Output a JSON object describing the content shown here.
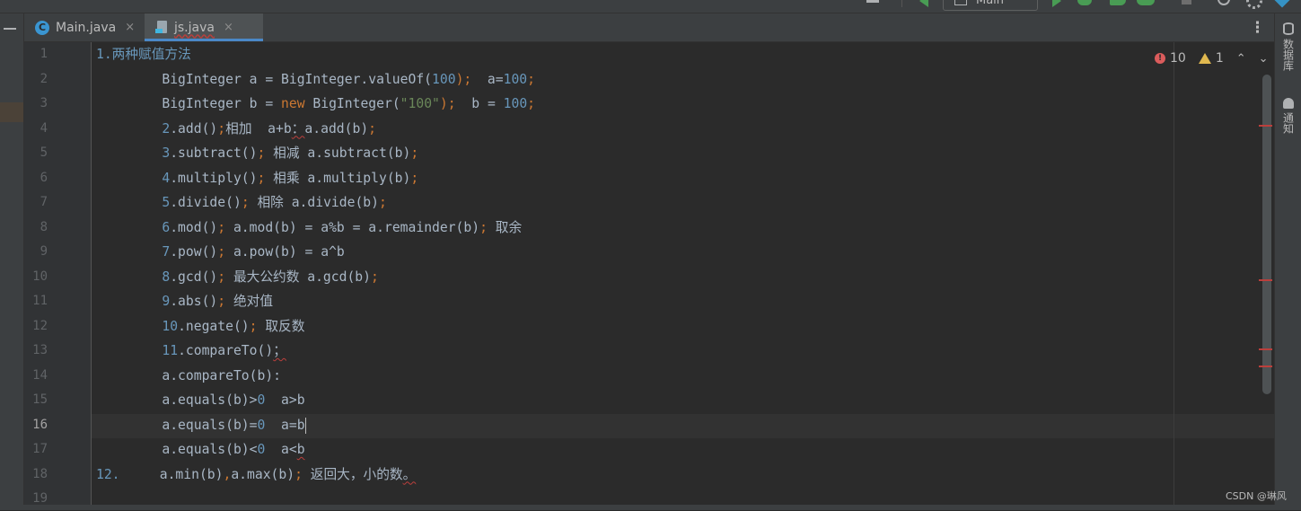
{
  "toolbar": {
    "run_config": "Main",
    "icons": [
      "minimize-icon",
      "back-run-icon",
      "run-icon",
      "debug-icon",
      "coverage-icon",
      "profile-icon",
      "stop-icon",
      "search-icon",
      "gear-icon",
      "update-icon"
    ]
  },
  "tabs": [
    {
      "label": "Main.java",
      "icon": "java-class-icon",
      "close": "×",
      "active": false
    },
    {
      "label": "js.java",
      "icon": "java-file-icon",
      "close": "×",
      "active": true
    }
  ],
  "inspection": {
    "errors": "10",
    "warnings": "1",
    "error_glyph": "!",
    "up": "⌃",
    "down": "⌄"
  },
  "tab_menu": "⋮",
  "current_line": 16,
  "line_numbers": [
    "1",
    "2",
    "3",
    "4",
    "5",
    "6",
    "7",
    "8",
    "9",
    "10",
    "11",
    "12",
    "13",
    "14",
    "15",
    "16",
    "17",
    "18",
    "19"
  ],
  "code_lines": [
    [
      {
        "t": "1.两种赋值方法",
        "c": "num1"
      }
    ],
    [
      {
        "t": "    BigInteger a = BigInteger.valueOf(",
        "c": "plain"
      },
      {
        "t": "100",
        "c": "num"
      },
      {
        "t": ");",
        "c": "semi"
      },
      {
        "t": "  a=",
        "c": "plain"
      },
      {
        "t": "100",
        "c": "num"
      },
      {
        "t": ";",
        "c": "semi"
      }
    ],
    [
      {
        "t": "    BigInteger b = ",
        "c": "plain"
      },
      {
        "t": "new",
        "c": "kw"
      },
      {
        "t": " BigInteger(",
        "c": "plain"
      },
      {
        "t": "\"100\"",
        "c": "str"
      },
      {
        "t": ");",
        "c": "semi"
      },
      {
        "t": "  b = ",
        "c": "plain"
      },
      {
        "t": "100",
        "c": "num"
      },
      {
        "t": ";",
        "c": "semi"
      }
    ],
    [
      {
        "t": "    ",
        "c": "plain"
      },
      {
        "t": "2",
        "c": "num"
      },
      {
        "t": ".add()",
        "c": "plain"
      },
      {
        "t": ";",
        "c": "semi"
      },
      {
        "t": "相加  a+b",
        "c": "plain"
      },
      {
        "t": "：",
        "c": "err"
      },
      {
        "t": "a.add(b)",
        "c": "plain"
      },
      {
        "t": ";",
        "c": "semi"
      }
    ],
    [
      {
        "t": "    ",
        "c": "plain"
      },
      {
        "t": "3",
        "c": "num"
      },
      {
        "t": ".subtract()",
        "c": "plain"
      },
      {
        "t": ";",
        "c": "semi"
      },
      {
        "t": " 相减 a.subtract(b)",
        "c": "plain"
      },
      {
        "t": ";",
        "c": "semi"
      }
    ],
    [
      {
        "t": "    ",
        "c": "plain"
      },
      {
        "t": "4",
        "c": "num"
      },
      {
        "t": ".multiply()",
        "c": "plain"
      },
      {
        "t": ";",
        "c": "semi"
      },
      {
        "t": " 相乘 a.multiply(b)",
        "c": "plain"
      },
      {
        "t": ";",
        "c": "semi"
      }
    ],
    [
      {
        "t": "    ",
        "c": "plain"
      },
      {
        "t": "5",
        "c": "num"
      },
      {
        "t": ".divide()",
        "c": "plain"
      },
      {
        "t": ";",
        "c": "semi"
      },
      {
        "t": " 相除 a.divide(b)",
        "c": "plain"
      },
      {
        "t": ";",
        "c": "semi"
      }
    ],
    [
      {
        "t": "    ",
        "c": "plain"
      },
      {
        "t": "6",
        "c": "num"
      },
      {
        "t": ".mod()",
        "c": "plain"
      },
      {
        "t": ";",
        "c": "semi"
      },
      {
        "t": " a.mod(b) = a%b = a.remainder(b)",
        "c": "plain"
      },
      {
        "t": ";",
        "c": "semi"
      },
      {
        "t": " 取余",
        "c": "plain"
      }
    ],
    [
      {
        "t": "    ",
        "c": "plain"
      },
      {
        "t": "7",
        "c": "num"
      },
      {
        "t": ".pow()",
        "c": "plain"
      },
      {
        "t": ";",
        "c": "semi"
      },
      {
        "t": " a.pow(b) = a^b",
        "c": "plain"
      }
    ],
    [
      {
        "t": "    ",
        "c": "plain"
      },
      {
        "t": "8",
        "c": "num"
      },
      {
        "t": ".gcd()",
        "c": "plain"
      },
      {
        "t": ";",
        "c": "semi"
      },
      {
        "t": " 最大公约数 a.gcd(b)",
        "c": "plain"
      },
      {
        "t": ";",
        "c": "semi"
      }
    ],
    [
      {
        "t": "    ",
        "c": "plain"
      },
      {
        "t": "9",
        "c": "num"
      },
      {
        "t": ".abs()",
        "c": "plain"
      },
      {
        "t": ";",
        "c": "semi"
      },
      {
        "t": " 绝对值",
        "c": "plain"
      }
    ],
    [
      {
        "t": "    ",
        "c": "plain"
      },
      {
        "t": "10",
        "c": "num"
      },
      {
        "t": ".negate()",
        "c": "plain"
      },
      {
        "t": ";",
        "c": "semi"
      },
      {
        "t": " 取反数",
        "c": "plain"
      }
    ],
    [
      {
        "t": "    ",
        "c": "plain"
      },
      {
        "t": "11",
        "c": "num"
      },
      {
        "t": ".compareTo()",
        "c": "plain"
      },
      {
        "t": "；",
        "c": "err"
      }
    ],
    [
      {
        "t": "    a.compareTo(b)",
        "c": "plain"
      },
      {
        "t": ":",
        "c": "plain"
      }
    ],
    [
      {
        "t": "    a.equals(b)>",
        "c": "plain"
      },
      {
        "t": "0",
        "c": "num"
      },
      {
        "t": "  a>b",
        "c": "plain"
      }
    ],
    [
      {
        "t": "    a.equals(b)=",
        "c": "plain"
      },
      {
        "t": "0",
        "c": "num"
      },
      {
        "t": "  a=b",
        "c": "plain"
      },
      {
        "t": "",
        "c": "caret"
      }
    ],
    [
      {
        "t": "    a.equals(b)<",
        "c": "plain"
      },
      {
        "t": "0",
        "c": "num"
      },
      {
        "t": "  a<",
        "c": "plain"
      },
      {
        "t": "b",
        "c": "errlite"
      }
    ],
    [
      {
        "t": "12.",
        "c": "num"
      },
      {
        "t": "     a.min(b)",
        "c": "plain"
      },
      {
        "t": ",",
        "c": "semi"
      },
      {
        "t": "a.max(b)",
        "c": "plain"
      },
      {
        "t": ";",
        "c": "semi"
      },
      {
        "t": " 返回大，小的数",
        "c": "plain"
      },
      {
        "t": "。",
        "c": "err"
      }
    ],
    []
  ],
  "right_tools": [
    {
      "label": "数据库",
      "icon": "database-icon"
    },
    {
      "label": "通知",
      "icon": "bell-icon"
    }
  ],
  "watermark": "CSDN @琳风",
  "colors": {
    "number": "#6897bb",
    "keyword": "#cc7832",
    "string": "#6a8759",
    "error": "#bc3f3c",
    "accent": "#4a88c7"
  }
}
